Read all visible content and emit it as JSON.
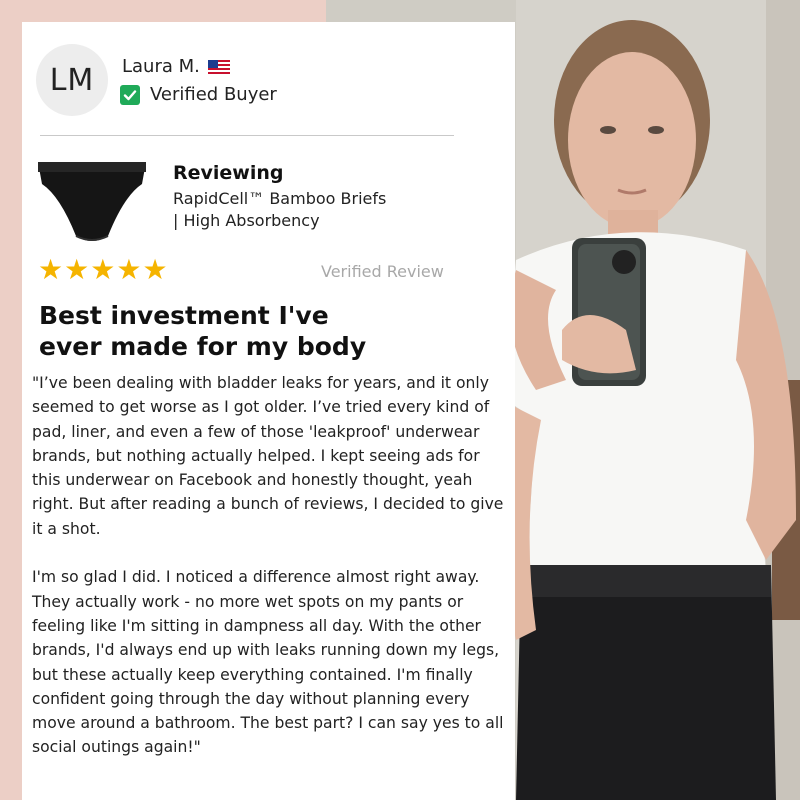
{
  "reviewer": {
    "initials": "LM",
    "name": "Laura M.",
    "flag_icon": "us-flag-icon",
    "badge_label": "Verified Buyer"
  },
  "product": {
    "reviewing_label": "Reviewing",
    "name_line1": "RapidCell™ Bamboo Briefs",
    "name_line2": "| High Absorbency",
    "image_icon": "black-briefs-image"
  },
  "rating": {
    "stars": 5,
    "max_stars": 5,
    "star_glyph": "★",
    "verified_label": "Verified Review"
  },
  "review": {
    "headline": "Best investment I've ever made for my body",
    "paragraph1": "\"I’ve been dealing with bladder leaks for years, and it only seemed to get worse as I got older. I’ve tried every kind of pad, liner, and even a few of those 'leakproof' underwear brands, but nothing actually helped. I kept seeing ads for this underwear on Facebook and honestly thought, yeah right. But after reading a bunch of reviews, I decided to give it a shot.",
    "paragraph2": "I'm so glad I did. I noticed a difference almost right away. They actually work - no more wet spots on my pants or feeling like I'm sitting in dampness all day. With the other brands, I'd always end up with leaks running down my legs, but these actually keep everything contained. I'm finally confident going through the day without planning every move around a bathroom. The best part? I can say yes to all social outings again!\""
  },
  "colors": {
    "background": "#eccfc6",
    "card": "#ffffff",
    "star": "#f5b400",
    "verified_green": "#1faa59"
  }
}
